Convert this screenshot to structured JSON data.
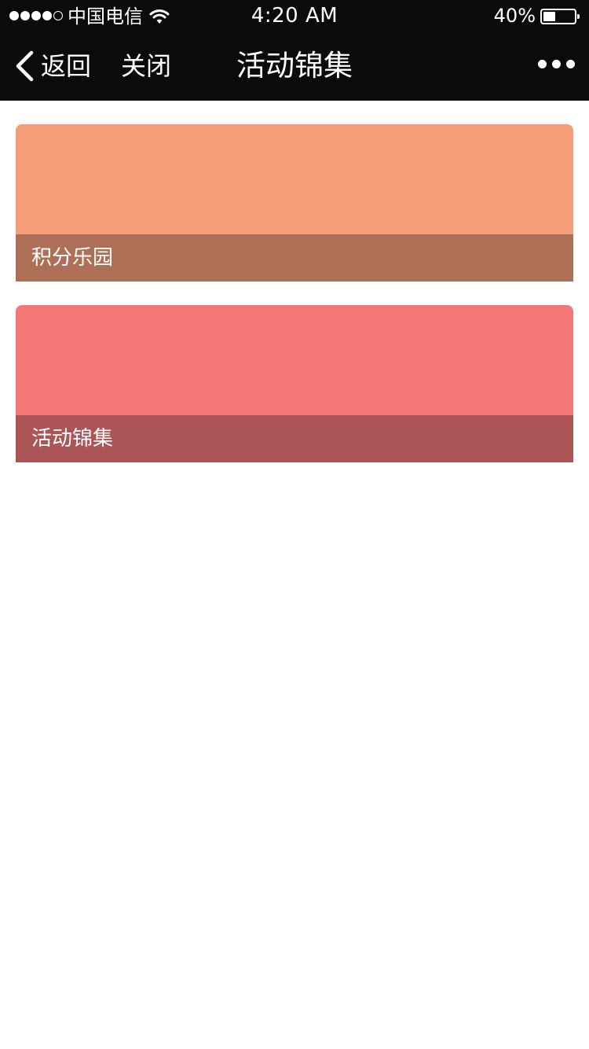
{
  "status_bar": {
    "signal_dots_filled": 4,
    "signal_dots_total": 5,
    "carrier": "中国电信",
    "time": "4:20 AM",
    "battery_percent": "40%",
    "battery_level": 0.4
  },
  "nav": {
    "back_label": "返回",
    "close_label": "关闭",
    "title": "活动锦集",
    "more_icon": "more-dots-icon"
  },
  "cards": [
    {
      "caption": "积分乐园",
      "image_color": "#f49d78",
      "caption_bg": "#ad6f56"
    },
    {
      "caption": "活动锦集",
      "image_color": "#f47778",
      "caption_bg": "#ac5556"
    }
  ]
}
